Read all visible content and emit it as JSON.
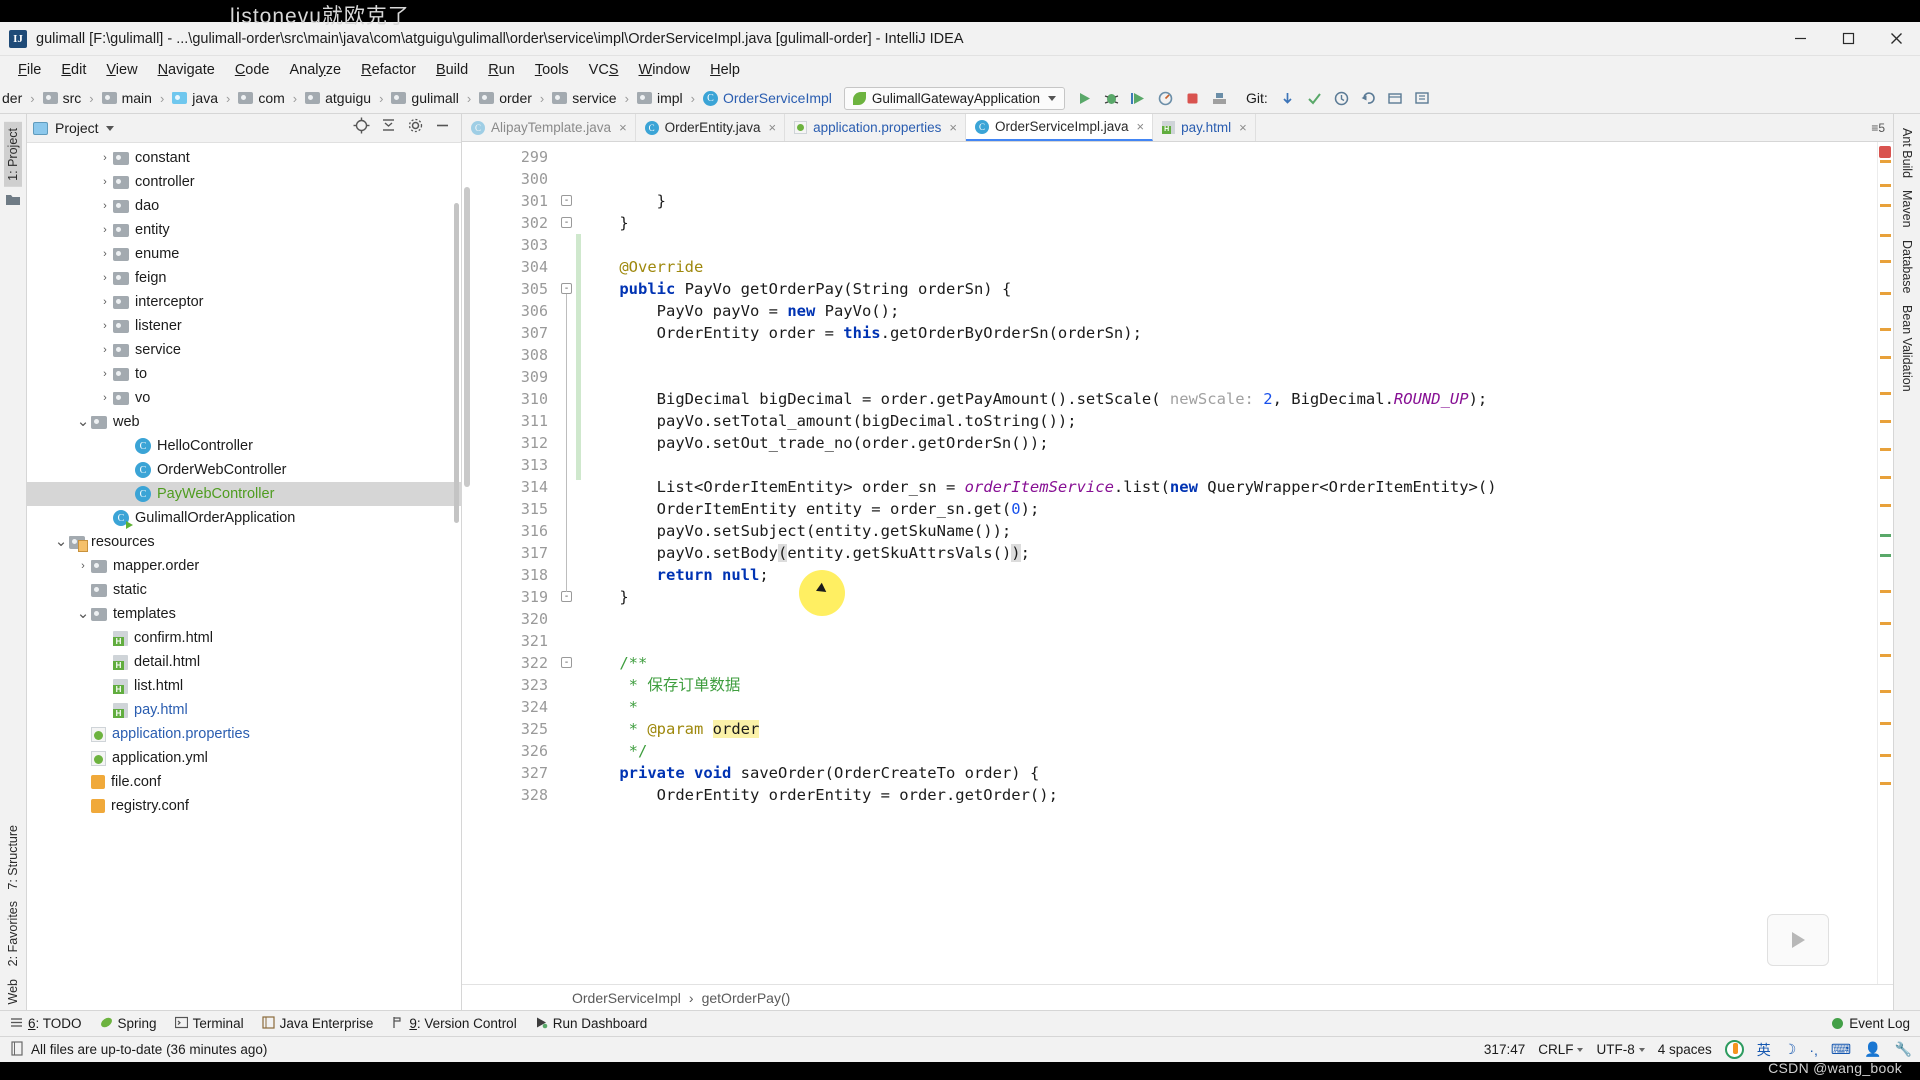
{
  "watermark": "listonevu就欧克了",
  "csdn_credit": "CSDN @wang_book",
  "titlebar": {
    "app_icon": "IJ",
    "title": "gulimall [F:\\gulimall] - ...\\gulimall-order\\src\\main\\java\\com\\atguigu\\gulimall\\order\\service\\impl\\OrderServiceImpl.java [gulimall-order] - IntelliJ IDEA",
    "minimize": "minimize-icon",
    "maximize": "maximize-icon",
    "close": "close-icon"
  },
  "menubar": {
    "items": [
      "File",
      "Edit",
      "View",
      "Navigate",
      "Code",
      "Analyze",
      "Refactor",
      "Build",
      "Run",
      "Tools",
      "VCS",
      "Window",
      "Help"
    ]
  },
  "navbar": {
    "crumbs": [
      {
        "label": "der",
        "icon": "none"
      },
      {
        "label": "src",
        "icon": "folder"
      },
      {
        "label": "main",
        "icon": "folder"
      },
      {
        "label": "java",
        "icon": "folder-blue"
      },
      {
        "label": "com",
        "icon": "folder"
      },
      {
        "label": "atguigu",
        "icon": "folder"
      },
      {
        "label": "gulimall",
        "icon": "folder"
      },
      {
        "label": "order",
        "icon": "folder"
      },
      {
        "label": "service",
        "icon": "folder"
      },
      {
        "label": "impl",
        "icon": "folder"
      },
      {
        "label": "OrderServiceImpl",
        "icon": "class"
      }
    ],
    "run_config": "GulimallGatewayApplication",
    "git_label": "Git:",
    "toolbar_icons": [
      "run-icon",
      "debug-icon",
      "run-coverage-icon",
      "profile-icon",
      "stop-icon",
      "build-icon",
      "search-everywhere-icon",
      "settings-icon"
    ],
    "git_icons": [
      "update-project-icon",
      "commit-icon",
      "history-icon",
      "revert-icon",
      "branch-icon",
      "push-icon"
    ]
  },
  "left_rail": {
    "items": [
      "1: Project",
      "7: Structure",
      "2: Favorites",
      "Web"
    ]
  },
  "right_rail": {
    "items": [
      "Ant Build",
      "Maven",
      "Database",
      "Bean Validation"
    ]
  },
  "project_panel": {
    "title": "Project",
    "locate_icon": "crosshair-icon",
    "collapse_icon": "collapse-all-icon",
    "settings_icon": "gear-icon",
    "hide_icon": "hide-icon",
    "tree": [
      {
        "label": "constant",
        "icon": "folder",
        "arrow": "collapsed",
        "indent": 3,
        "color": ""
      },
      {
        "label": "controller",
        "icon": "folder",
        "arrow": "collapsed",
        "indent": 3,
        "color": ""
      },
      {
        "label": "dao",
        "icon": "folder",
        "arrow": "collapsed",
        "indent": 3,
        "color": ""
      },
      {
        "label": "entity",
        "icon": "folder",
        "arrow": "collapsed",
        "indent": 3,
        "color": ""
      },
      {
        "label": "enume",
        "icon": "folder",
        "arrow": "collapsed",
        "indent": 3,
        "color": ""
      },
      {
        "label": "feign",
        "icon": "folder",
        "arrow": "collapsed",
        "indent": 3,
        "color": ""
      },
      {
        "label": "interceptor",
        "icon": "folder",
        "arrow": "collapsed",
        "indent": 3,
        "color": ""
      },
      {
        "label": "listener",
        "icon": "folder",
        "arrow": "collapsed",
        "indent": 3,
        "color": ""
      },
      {
        "label": "service",
        "icon": "folder",
        "arrow": "collapsed",
        "indent": 3,
        "color": ""
      },
      {
        "label": "to",
        "icon": "folder",
        "arrow": "collapsed",
        "indent": 3,
        "color": ""
      },
      {
        "label": "vo",
        "icon": "folder",
        "arrow": "collapsed",
        "indent": 3,
        "color": ""
      },
      {
        "label": "web",
        "icon": "folder",
        "arrow": "expanded",
        "indent": 2,
        "color": ""
      },
      {
        "label": "HelloController",
        "icon": "class",
        "arrow": "none",
        "indent": 4,
        "color": ""
      },
      {
        "label": "OrderWebController",
        "icon": "class",
        "arrow": "none",
        "indent": 4,
        "color": ""
      },
      {
        "label": "PayWebController",
        "icon": "class",
        "arrow": "none",
        "indent": 4,
        "color": "green",
        "selected": true
      },
      {
        "label": "GulimallOrderApplication",
        "icon": "class-run",
        "arrow": "none",
        "indent": 3,
        "color": ""
      },
      {
        "label": "resources",
        "icon": "folder-res",
        "arrow": "expanded",
        "indent": 1,
        "color": ""
      },
      {
        "label": "mapper.order",
        "icon": "folder",
        "arrow": "collapsed",
        "indent": 2,
        "color": ""
      },
      {
        "label": "static",
        "icon": "folder",
        "arrow": "none",
        "indent": 2,
        "color": ""
      },
      {
        "label": "templates",
        "icon": "folder",
        "arrow": "expanded",
        "indent": 2,
        "color": ""
      },
      {
        "label": "confirm.html",
        "icon": "html",
        "arrow": "none",
        "indent": 3,
        "color": ""
      },
      {
        "label": "detail.html",
        "icon": "html",
        "arrow": "none",
        "indent": 3,
        "color": ""
      },
      {
        "label": "list.html",
        "icon": "html",
        "arrow": "none",
        "indent": 3,
        "color": ""
      },
      {
        "label": "pay.html",
        "icon": "html",
        "arrow": "none",
        "indent": 3,
        "color": "blue"
      },
      {
        "label": "application.properties",
        "icon": "props",
        "arrow": "none",
        "indent": 2,
        "color": "blue"
      },
      {
        "label": "application.yml",
        "icon": "props",
        "arrow": "none",
        "indent": 2,
        "color": ""
      },
      {
        "label": "file.conf",
        "icon": "conf",
        "arrow": "none",
        "indent": 2,
        "color": ""
      },
      {
        "label": "registry.conf",
        "icon": "conf",
        "arrow": "none",
        "indent": 2,
        "color": ""
      }
    ]
  },
  "editor": {
    "tabs": [
      {
        "label": "AlipayTemplate.java",
        "icon": "class",
        "active": false,
        "dim": true,
        "close": "×"
      },
      {
        "label": "OrderEntity.java",
        "icon": "class",
        "active": false,
        "dim": false,
        "close": "×"
      },
      {
        "label": "application.properties",
        "icon": "props",
        "active": false,
        "dim": false,
        "color": "blue",
        "close": "×"
      },
      {
        "label": "OrderServiceImpl.java",
        "icon": "class",
        "active": true,
        "dim": false,
        "close": "×"
      },
      {
        "label": "pay.html",
        "icon": "html",
        "active": false,
        "dim": false,
        "color": "blue",
        "close": "×"
      }
    ],
    "tab_overflow": "≡5",
    "breadcrumb": [
      "OrderServiceImpl",
      "getOrderPay()"
    ],
    "first_line": 299,
    "lines": [
      {
        "n": 299,
        "code": ""
      },
      {
        "n": 300,
        "code": ""
      },
      {
        "n": 301,
        "code": "        }"
      },
      {
        "n": 302,
        "code": "    }"
      },
      {
        "n": 303,
        "code": ""
      },
      {
        "n": 304,
        "code": "    @Override"
      },
      {
        "n": 305,
        "code": "    public PayVo getOrderPay(String orderSn) {"
      },
      {
        "n": 306,
        "code": "        PayVo payVo = new PayVo();"
      },
      {
        "n": 307,
        "code": "        OrderEntity order = this.getOrderByOrderSn(orderSn);"
      },
      {
        "n": 308,
        "code": ""
      },
      {
        "n": 309,
        "code": ""
      },
      {
        "n": 310,
        "code": "        BigDecimal bigDecimal = order.getPayAmount().setScale( newScale: 2, BigDecimal.ROUND_UP);"
      },
      {
        "n": 311,
        "code": "        payVo.setTotal_amount(bigDecimal.toString());"
      },
      {
        "n": 312,
        "code": "        payVo.setOut_trade_no(order.getOrderSn());"
      },
      {
        "n": 313,
        "code": ""
      },
      {
        "n": 314,
        "code": "        List<OrderItemEntity> order_sn = orderItemService.list(new QueryWrapper<OrderItemEntity>()"
      },
      {
        "n": 315,
        "code": "        OrderItemEntity entity = order_sn.get(0);"
      },
      {
        "n": 316,
        "code": "        payVo.setSubject(entity.getSkuName());"
      },
      {
        "n": 317,
        "code": "        payVo.setBody(entity.getSkuAttrsVals());"
      },
      {
        "n": 318,
        "code": "        return null;"
      },
      {
        "n": 319,
        "code": "    }"
      },
      {
        "n": 320,
        "code": ""
      },
      {
        "n": 321,
        "code": ""
      },
      {
        "n": 322,
        "code": "    /**"
      },
      {
        "n": 323,
        "code": "     * 保存订单数据"
      },
      {
        "n": 324,
        "code": "     *"
      },
      {
        "n": 325,
        "code": "     * @param order"
      },
      {
        "n": 326,
        "code": "     */"
      },
      {
        "n": 327,
        "code": "    private void saveOrder(OrderCreateTo order) {"
      },
      {
        "n": 328,
        "code": "        OrderEntity orderEntity = order.getOrder();"
      }
    ]
  },
  "tool_window_bar": {
    "items": [
      {
        "num": "6",
        "label": ": TODO",
        "icon": "todo-icon"
      },
      {
        "num": "",
        "label": "Spring",
        "icon": "spring-icon"
      },
      {
        "num": "",
        "label": "Terminal",
        "icon": "terminal-icon"
      },
      {
        "num": "",
        "label": "Java Enterprise",
        "icon": "java-enterprise-icon"
      },
      {
        "num": "9",
        "label": ": Version Control",
        "icon": "version-control-icon"
      },
      {
        "num": "",
        "label": "Run Dashboard",
        "icon": "run-dashboard-icon"
      }
    ],
    "event_log": "Event Log"
  },
  "statusbar": {
    "message": "All files are up-to-date (36 minutes ago)",
    "message_icon": "file-icon",
    "caret_position": "317:47",
    "line_separator": "CRLF",
    "encoding": "UTF-8",
    "indent": "4 spaces",
    "ime_letter": "英",
    "tray_icons": [
      "ime-logo-icon",
      "ime-lang-icon",
      "moon-icon",
      "punctuation-icon",
      "keyboard-icon",
      "user-icon",
      "wrench-icon"
    ]
  }
}
